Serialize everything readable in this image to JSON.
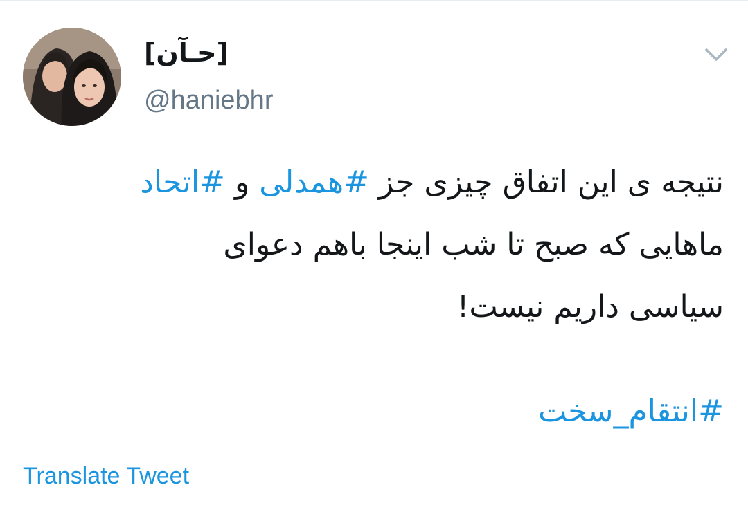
{
  "author": {
    "display_name": "[حـآن]",
    "handle": "@haniebhr",
    "avatar_icon": "profile-photo"
  },
  "tweet": {
    "line1_before": "نتیجه ی این اتفاق چیزی جز ",
    "hashtag1": "#همدلی",
    "line1_middle": " و ",
    "hashtag2": "#اتحاد",
    "line2": "ماهایی که صبح تا شب اینجا باهم دعوای",
    "line3": "سیاسی داریم نیست!",
    "hashtag3": "#انتقام_سخت"
  },
  "actions": {
    "translate_label": "Translate Tweet",
    "more_icon": "chevron-down-icon"
  },
  "colors": {
    "link": "#1b95e0",
    "text": "#14171a",
    "secondary": "#657786",
    "caret": "#aab8c2"
  }
}
